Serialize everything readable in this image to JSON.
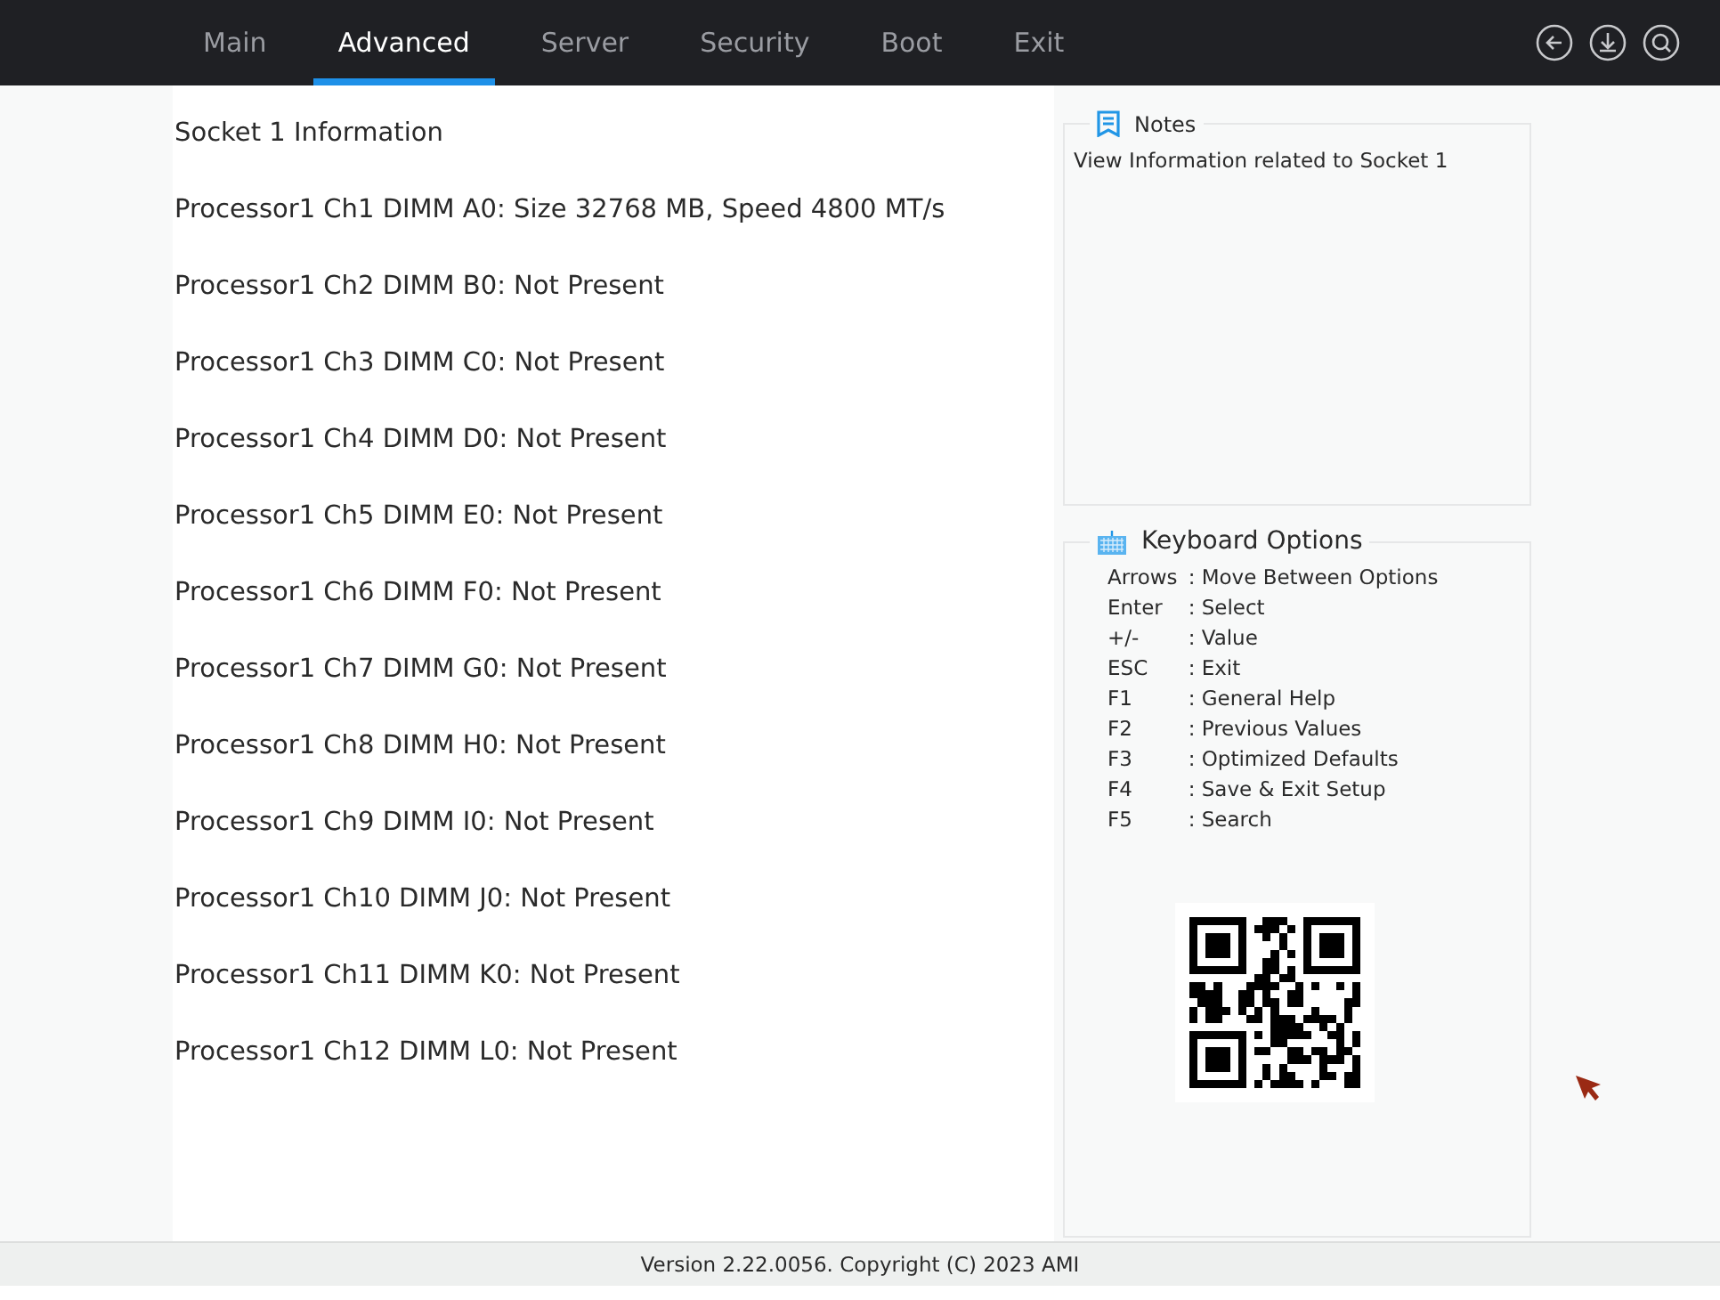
{
  "tabs": [
    {
      "label": "Main",
      "selected": false
    },
    {
      "label": "Advanced",
      "selected": true
    },
    {
      "label": "Server",
      "selected": false
    },
    {
      "label": "Security",
      "selected": false
    },
    {
      "label": "Boot",
      "selected": false
    },
    {
      "label": "Exit",
      "selected": false
    }
  ],
  "content": {
    "lines": [
      "Socket 1 Information",
      "Processor1 Ch1 DIMM A0: Size 32768 MB, Speed 4800 MT/s",
      "Processor1 Ch2 DIMM B0: Not Present",
      "Processor1 Ch3 DIMM C0: Not Present",
      "Processor1 Ch4 DIMM D0: Not Present",
      "Processor1 Ch5 DIMM E0: Not Present",
      "Processor1 Ch6 DIMM F0: Not Present",
      "Processor1 Ch7 DIMM G0: Not Present",
      "Processor1 Ch8 DIMM H0: Not Present",
      "Processor1 Ch9 DIMM I0: Not Present",
      "Processor1 Ch10 DIMM J0: Not Present",
      "Processor1 Ch11 DIMM K0: Not Present",
      "Processor1 Ch12 DIMM L0: Not Present"
    ]
  },
  "notes": {
    "title": "Notes",
    "text": "View Information related to Socket 1"
  },
  "keyboard_options": {
    "title": "Keyboard Options",
    "items": [
      {
        "key": "Arrows",
        "description": ": Move Between Options"
      },
      {
        "key": "Enter",
        "description": ": Select"
      },
      {
        "key": "+/-",
        "description": ": Value"
      },
      {
        "key": "ESC",
        "description": ": Exit"
      },
      {
        "key": "F1",
        "description": ": General Help"
      },
      {
        "key": "F2",
        "description": ": Previous Values"
      },
      {
        "key": "F3",
        "description": ": Optimized Defaults"
      },
      {
        "key": "F4",
        "description": ": Save & Exit Setup"
      },
      {
        "key": "F5",
        "description": ": Search"
      }
    ]
  },
  "status_bar": {
    "text": "Version 2.22.0056. Copyright (C) 2023 AMI"
  }
}
